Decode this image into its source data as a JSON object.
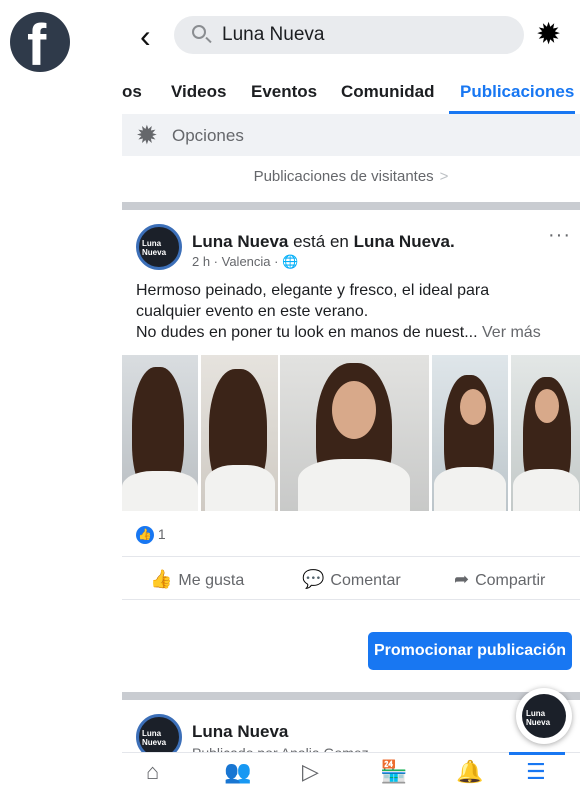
{
  "colors": {
    "accent": "#1877f2",
    "muted": "#65676b",
    "text": "#1c1e21",
    "logo_bg": "#2f3a4a"
  },
  "logo": {
    "glyph": "f",
    "icon": "facebook-logo-icon"
  },
  "search": {
    "query": "Luna Nueva",
    "back_icon": "chevron-left-icon",
    "search_icon": "search-icon",
    "settings_icon": "gear-icon"
  },
  "tabs": [
    {
      "label": "os",
      "active": false
    },
    {
      "label": "Videos",
      "active": false
    },
    {
      "label": "Eventos",
      "active": false
    },
    {
      "label": "Comunidad",
      "active": false
    },
    {
      "label": "Publicaciones",
      "active": true
    }
  ],
  "options": {
    "label": "Opciones",
    "icon": "gear-icon"
  },
  "visitors": {
    "label": "Publicaciones de visitantes",
    "chevron": ">"
  },
  "post": {
    "author": "Luna Nueva",
    "connector": "está en",
    "place": "Luna Nueva.",
    "meta": "2 h · Valencia · ",
    "privacy_icon": "globe-icon",
    "avatar_text": "Luna Nueva",
    "text_lines": [
      "Hermoso peinado, elegante y fresco, el ideal para",
      "cualquier evento en este verano.",
      "No dudes en poner tu look en manos de nuest..."
    ],
    "see_more": "Ver más",
    "more_label": "···",
    "reaction_count": "1",
    "actions": {
      "like": "Me gusta",
      "comment": "Comentar",
      "share": "Compartir"
    },
    "promote": "Promocionar publicación"
  },
  "post2": {
    "author": "Luna Nueva",
    "subtitle": "Publicado por Analia Gomez"
  },
  "fab": {
    "text": "Luna Nueva"
  },
  "bottom_nav": [
    {
      "icon": "home-icon",
      "active": false
    },
    {
      "icon": "friends-icon",
      "active": false
    },
    {
      "icon": "watch-icon",
      "active": false
    },
    {
      "icon": "marketplace-icon",
      "active": false
    },
    {
      "icon": "notifications-icon",
      "active": false
    },
    {
      "icon": "menu-icon",
      "active": true
    }
  ]
}
